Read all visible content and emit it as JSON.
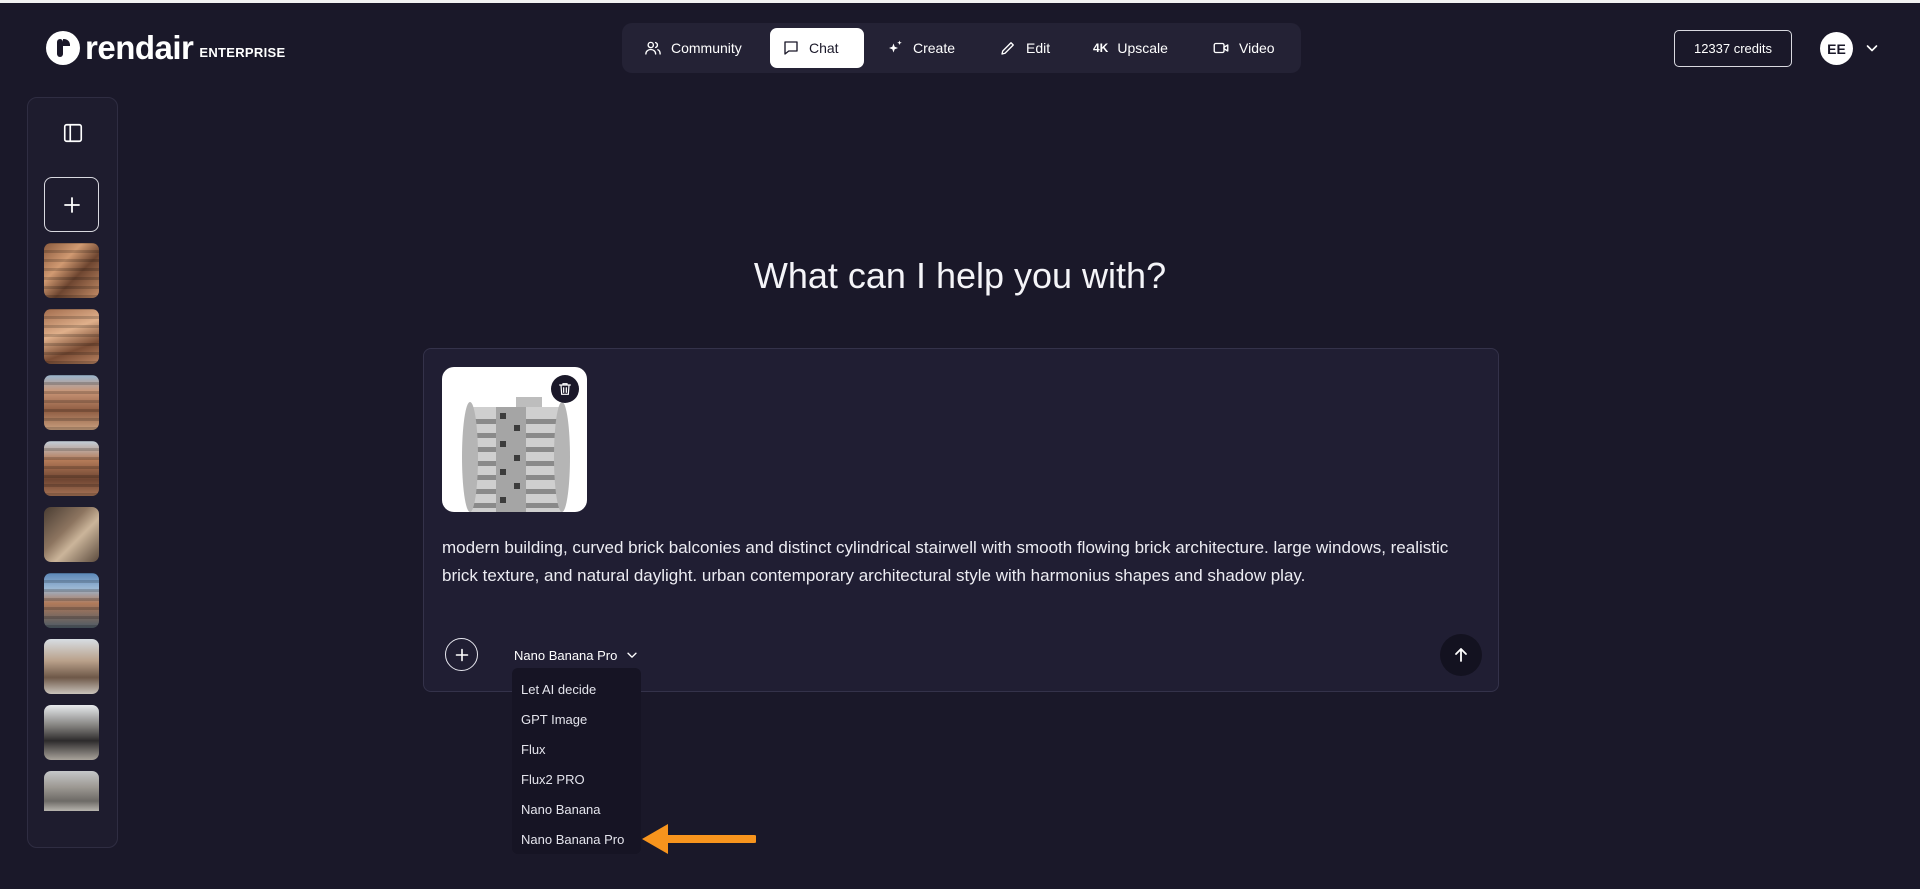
{
  "brand": {
    "name": "rendair",
    "tier": "ENTERPRISE"
  },
  "nav": {
    "tabs": [
      {
        "label": "Community",
        "icon": "users-icon",
        "active": false
      },
      {
        "label": "Chat",
        "icon": "chat-bubble-icon",
        "active": true
      },
      {
        "label": "Create",
        "icon": "sparkles-icon",
        "active": false
      },
      {
        "label": "Edit",
        "icon": "pencil-icon",
        "active": false
      },
      {
        "label": "Upscale",
        "icon_text": "4K",
        "active": false
      },
      {
        "label": "Video",
        "icon": "video-camera-icon",
        "active": false
      }
    ]
  },
  "account": {
    "credits": "12337 credits",
    "initials": "EE"
  },
  "sidebar": {
    "toggle_icon": "sidebar-panel-icon",
    "new_chat_icon": "plus-icon",
    "history": [
      "thumb-1",
      "thumb-2",
      "thumb-3",
      "thumb-4",
      "thumb-5",
      "thumb-6",
      "thumb-7",
      "thumb-8",
      "thumb-9"
    ]
  },
  "main": {
    "headline": "What can I help you with?",
    "composer": {
      "prompt": "modern building, curved brick balconies and distinct cylindrical stairwell with smooth flowing brick architecture. large windows, realistic brick texture, and natural daylight. urban contemporary architectural style with harmonius shapes and shadow play.",
      "selected_model": "Nano Banana Pro",
      "model_options": [
        "Let AI decide",
        "GPT Image",
        "Flux",
        "Flux2 PRO",
        "Nano Banana",
        "Nano Banana Pro"
      ]
    }
  },
  "colors": {
    "background": "#1a1829",
    "panel": "#201e33",
    "nav_bg": "#242235",
    "accent_arrow": "#f7941d"
  }
}
